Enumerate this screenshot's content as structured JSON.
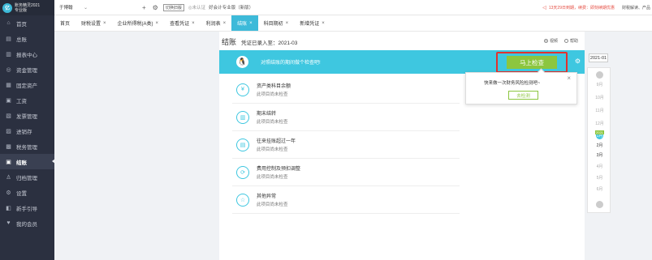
{
  "logo": {
    "mark": "亿",
    "line1": "账务精灵2021",
    "line2": "专业版"
  },
  "sidebar": {
    "items": [
      {
        "label": "首页",
        "icon": "home-icon",
        "glyph": "⌂"
      },
      {
        "label": "总账",
        "icon": "ledger-icon",
        "glyph": "▤"
      },
      {
        "label": "报表中心",
        "icon": "report-icon",
        "glyph": "▥"
      },
      {
        "label": "资金管理",
        "icon": "fund-icon",
        "glyph": "◎"
      },
      {
        "label": "固定资产",
        "icon": "asset-icon",
        "glyph": "▦"
      },
      {
        "label": "工资",
        "icon": "salary-icon",
        "glyph": "▣"
      },
      {
        "label": "发票管理",
        "icon": "invoice-icon",
        "glyph": "▧"
      },
      {
        "label": "进销存",
        "icon": "inventory-icon",
        "glyph": "▨"
      },
      {
        "label": "税务管理",
        "icon": "tax-icon",
        "glyph": "▩"
      },
      {
        "label": "结账",
        "icon": "closing-icon",
        "glyph": "▣",
        "active": true
      },
      {
        "label": "归档管理",
        "icon": "archive-icon",
        "glyph": "♙"
      },
      {
        "label": "设置",
        "icon": "settings-icon",
        "glyph": "⚙"
      },
      {
        "label": "新手引导",
        "icon": "guide-icon",
        "glyph": "◧"
      },
      {
        "label": "我的会员",
        "icon": "vip-icon",
        "glyph": "♥"
      }
    ]
  },
  "topbar": {
    "company": "于博翰",
    "caret": "⌄",
    "add": "+",
    "settings_glyph": "⚙",
    "button": "切换旧版",
    "status_gray": "◎未认证",
    "industry": "好会计专业版（新版）",
    "notice": "13天29日到期，续费：即刻续期优惠",
    "notice_icon": "◁",
    "right": "财税解读、产品"
  },
  "tabs": [
    {
      "label": "首页",
      "closable": false
    },
    {
      "label": "财税设置",
      "closable": true
    },
    {
      "label": "企业所得税(A类)",
      "closable": true
    },
    {
      "label": "查看凭证",
      "closable": true
    },
    {
      "label": "利润表",
      "closable": true
    },
    {
      "label": "结账",
      "closable": true,
      "active": true
    },
    {
      "label": "科目期初",
      "closable": true
    },
    {
      "label": "新增凭证",
      "closable": true
    }
  ],
  "main": {
    "title": "结账",
    "voucher_status": "凭证已录入至：2021-03",
    "view_options": [
      "视频",
      "帮助"
    ],
    "banner_text": "对照结账的期间做个检查吧!",
    "check_button": "马上检查",
    "items": [
      {
        "name": "资产类科目余额",
        "status": "此项目尚未检查",
        "icon": "currency-icon",
        "glyph": "¥"
      },
      {
        "name": "期末结转",
        "status": "此项目尚未检查",
        "icon": "transfer-icon",
        "glyph": "▥"
      },
      {
        "name": "往来挂账超过一年",
        "status": "此项目尚未检查",
        "icon": "payable-icon",
        "glyph": "▤"
      },
      {
        "name": "费用控制及预扣调整",
        "status": "此项目尚未检查",
        "icon": "expense-icon",
        "glyph": "⟳"
      },
      {
        "name": "其他异常",
        "status": "此项目尚未检查",
        "icon": "star-icon",
        "glyph": "☆"
      }
    ]
  },
  "popup": {
    "text": "快来做一次财务风险检测吧~",
    "button": "去检测",
    "close": "×"
  },
  "period": {
    "value": "2021-01",
    "months": [
      "9月",
      "10月",
      "11月",
      "12月",
      "1月",
      "2月",
      "3月",
      "4月",
      "5月",
      "6月"
    ],
    "current_badge": "2021",
    "current_label": "1月"
  }
}
